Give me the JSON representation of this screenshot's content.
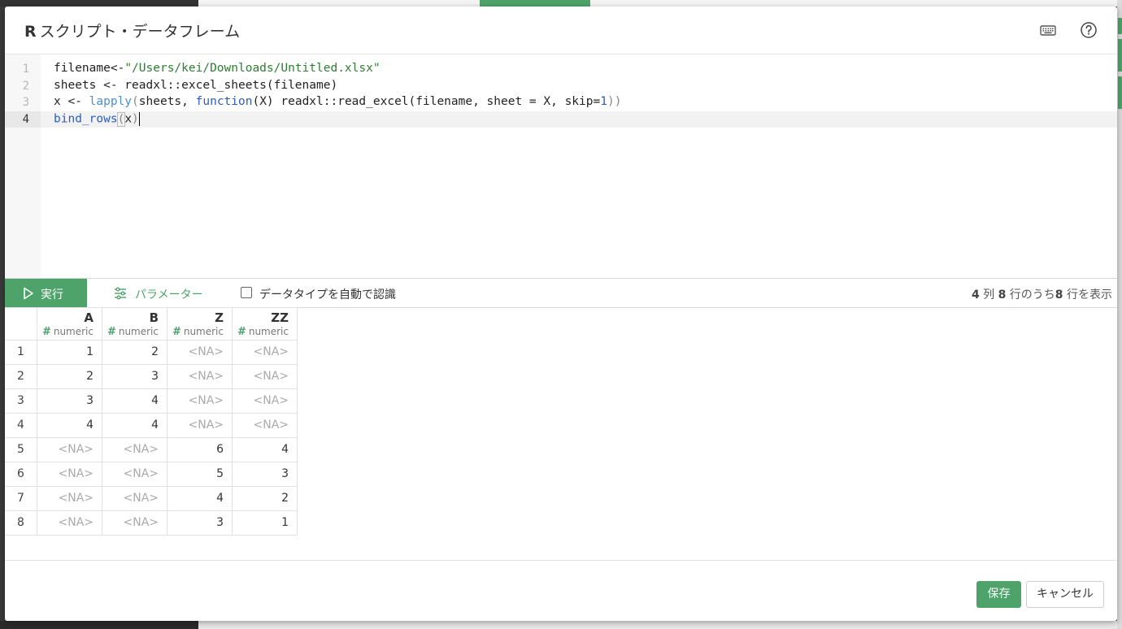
{
  "dialog": {
    "title_prefix": "R",
    "title": "スクリプト・データフレーム",
    "keyboard_icon": "keyboard-icon",
    "help_icon": "help-icon"
  },
  "editor": {
    "line_numbers": [
      "1",
      "2",
      "3",
      "4"
    ],
    "active_line": "4",
    "lines": {
      "l1_a": "filename<-",
      "l1_str": "\"/Users/kei/Downloads/Untitled.xlsx\"",
      "l2": "sheets <- readxl::excel_sheets(filename)",
      "l3_a": "x <- ",
      "l3_fn": "lapply",
      "l3_p1": "(",
      "l3_b": "sheets, ",
      "l3_kw": "function",
      "l3_c": "(X) readxl::read_excel(filename, sheet = X, skip=",
      "l3_num": "1",
      "l3_p2": "))",
      "l4_fn": "bind_rows",
      "l4_p1": "(",
      "l4_b": "x",
      "l4_p2": ")"
    }
  },
  "toolbar": {
    "run_label": "実行",
    "params_label": "パラメーター",
    "auto_detect_label": "データタイプを自動で認識",
    "auto_detect_checked": false,
    "col_count": "4",
    "col_unit": " 列 ",
    "row_total": "8",
    "row_mid": " 行のうち",
    "row_shown": "8",
    "row_suffix": " 行を表示"
  },
  "table": {
    "columns": [
      {
        "name": "A",
        "type": "numeric"
      },
      {
        "name": "B",
        "type": "numeric"
      },
      {
        "name": "Z",
        "type": "numeric"
      },
      {
        "name": "ZZ",
        "type": "numeric"
      }
    ],
    "type_hash": "#",
    "rows": [
      {
        "index": "1",
        "values": [
          "1",
          "2",
          "<NA>",
          "<NA>"
        ]
      },
      {
        "index": "2",
        "values": [
          "2",
          "3",
          "<NA>",
          "<NA>"
        ]
      },
      {
        "index": "3",
        "values": [
          "3",
          "4",
          "<NA>",
          "<NA>"
        ]
      },
      {
        "index": "4",
        "values": [
          "4",
          "4",
          "<NA>",
          "<NA>"
        ]
      },
      {
        "index": "5",
        "values": [
          "<NA>",
          "<NA>",
          "6",
          "4"
        ]
      },
      {
        "index": "6",
        "values": [
          "<NA>",
          "<NA>",
          "5",
          "3"
        ]
      },
      {
        "index": "7",
        "values": [
          "<NA>",
          "<NA>",
          "4",
          "2"
        ]
      },
      {
        "index": "8",
        "values": [
          "<NA>",
          "<NA>",
          "3",
          "1"
        ]
      }
    ]
  },
  "footer": {
    "save_label": "保存",
    "cancel_label": "キャンセル"
  },
  "colors": {
    "accent": "#4ea36b",
    "na_text": "#aaaaaa"
  }
}
